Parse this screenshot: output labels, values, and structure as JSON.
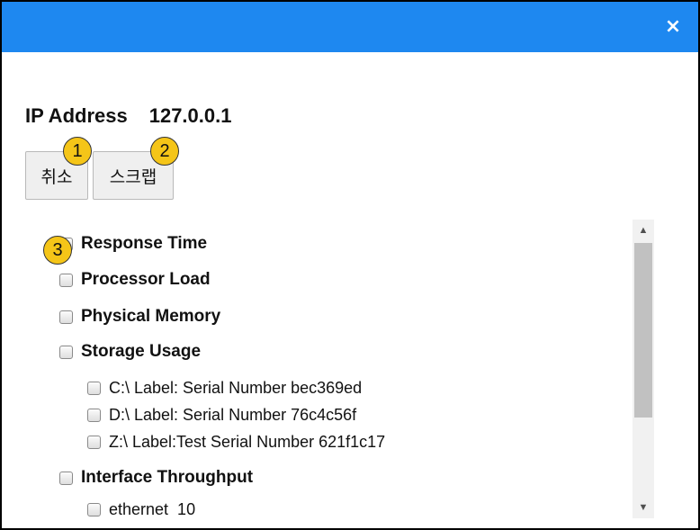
{
  "dialog": {
    "close_glyph": "×",
    "ip_label": "IP Address",
    "ip_value": "127.0.0.1"
  },
  "buttons": {
    "cancel_label": "취소",
    "scrap_label": "스크랩"
  },
  "badges": [
    "1",
    "2",
    "3"
  ],
  "items": {
    "response_time": "Response Time",
    "processor_load": "Processor Load",
    "physical_memory": "Physical Memory",
    "storage_usage": "Storage Usage",
    "drive_c": "C:\\ Label: Serial Number bec369ed",
    "drive_d": "D:\\ Label: Serial Number 76c4c56f",
    "drive_z": "Z:\\ Label:Test Serial Number 621f1c17",
    "interface_throughput": "Interface Throughput",
    "ethernet": "ethernet  10"
  },
  "colors": {
    "titlebar": "#1e88f0",
    "badge": "#f5c518"
  }
}
